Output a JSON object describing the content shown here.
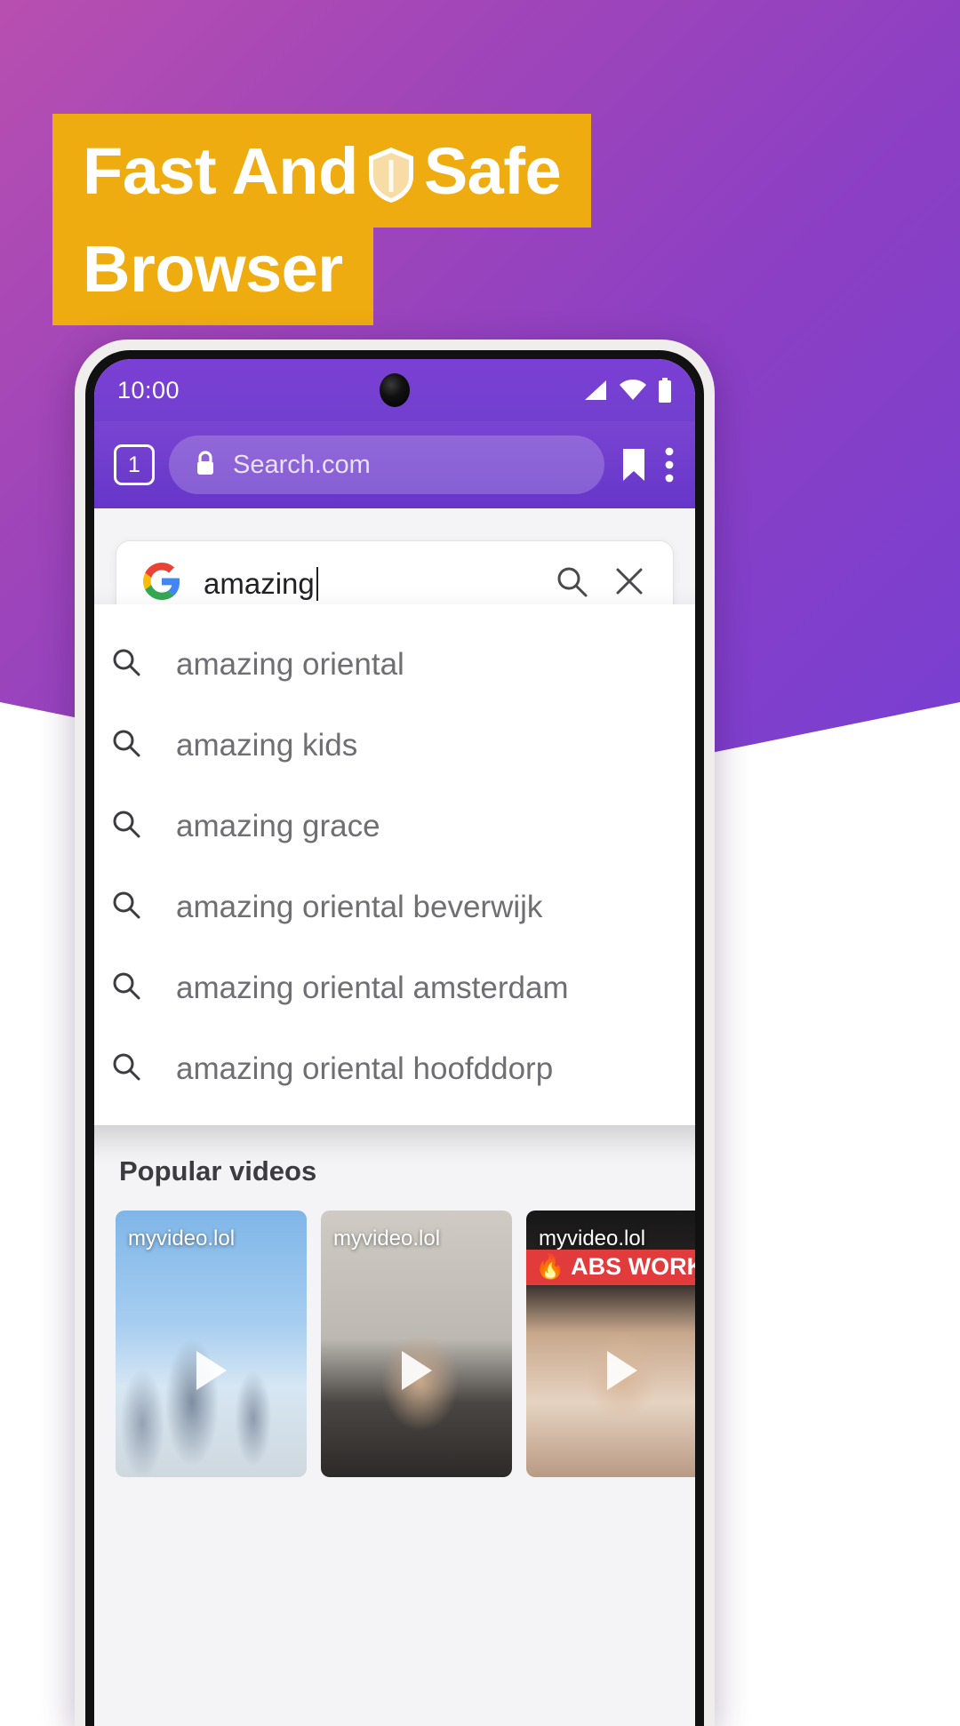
{
  "promo": {
    "headline_line1_before": "Fast And",
    "headline_shield_icon": "shield-icon",
    "headline_line1_after": "Safe",
    "headline_line2": "Browser",
    "banner_color": "#efac11",
    "background_gradient_start": "#b84fb0",
    "background_gradient_end": "#6d3fd8"
  },
  "phone": {
    "status_bar": {
      "clock": "10:00",
      "icons": [
        "signal-icon",
        "wifi-icon",
        "battery-icon"
      ],
      "camera": "front-camera-punch-hole"
    },
    "browser_toolbar": {
      "tab_count": "1",
      "lock_icon": "lock-icon",
      "address_text": "Search.com",
      "bookmark_icon": "bookmark-icon",
      "menu_icon": "overflow-menu-icon",
      "toolbar_color": "#7a44d2"
    },
    "search_card": {
      "engine_icon": "google-g-icon",
      "query": "amazing",
      "search_icon": "search-icon",
      "clear_icon": "close-icon"
    },
    "suggestions": [
      {
        "text": "amazing oriental",
        "icon": "search-icon",
        "action_icon": "arrow-up-left-icon"
      },
      {
        "text": "amazing kids",
        "icon": "search-icon",
        "action_icon": "arrow-up-left-icon"
      },
      {
        "text": "amazing grace",
        "icon": "search-icon",
        "action_icon": "arrow-up-left-icon"
      },
      {
        "text": "amazing oriental beverwijk",
        "icon": "search-icon",
        "action_icon": "arrow-up-left-icon"
      },
      {
        "text": "amazing oriental amsterdam",
        "icon": "search-icon",
        "action_icon": "arrow-up-left-icon"
      },
      {
        "text": "amazing oriental hoofddorp",
        "icon": "search-icon",
        "action_icon": "arrow-up-left-icon"
      }
    ],
    "popular_videos": {
      "title": "Popular videos",
      "items": [
        {
          "source": "myvideo.lol",
          "banner": "",
          "thumb": "snow-forest"
        },
        {
          "source": "myvideo.lol",
          "banner": "",
          "thumb": "indoor-person"
        },
        {
          "source": "myvideo.lol",
          "banner": "🔥 ABS WORKOUT",
          "thumb": "workout"
        }
      ]
    }
  }
}
